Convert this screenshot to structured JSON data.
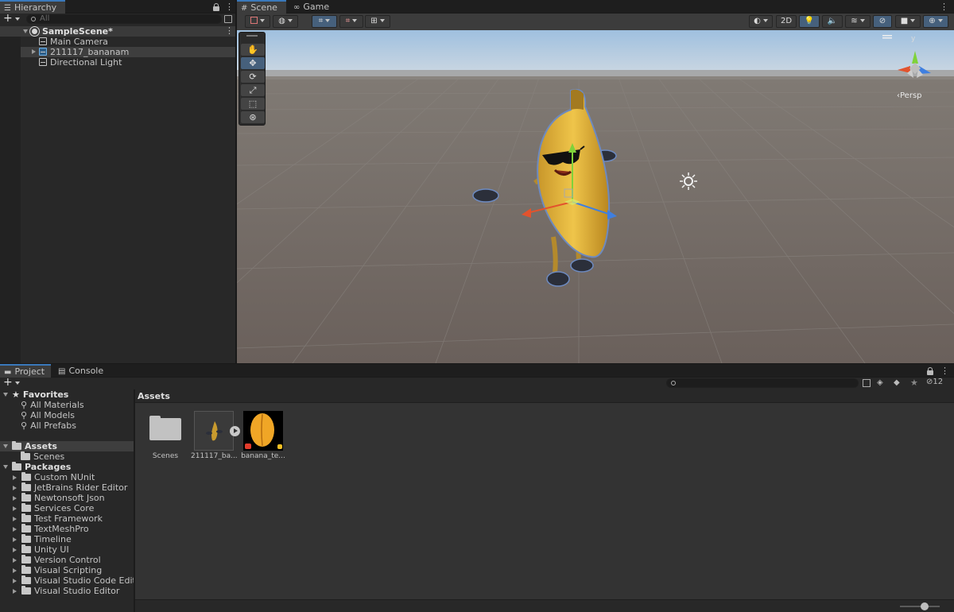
{
  "hierarchy": {
    "tab_label": "Hierarchy",
    "add_label": "+",
    "search_placeholder": "All",
    "scene_name": "SampleScene*",
    "items": [
      {
        "label": "Main Camera"
      },
      {
        "label": "211117_bananam"
      },
      {
        "label": "Directional Light"
      }
    ]
  },
  "scene_view": {
    "tabs": [
      {
        "label": "Scene"
      },
      {
        "label": "Game"
      }
    ],
    "btn_2d": "2D",
    "persp_label": "Persp",
    "gizmo_axis_y": "y"
  },
  "project": {
    "tabs": [
      {
        "label": "Project"
      },
      {
        "label": "Console"
      }
    ],
    "add_label": "+",
    "hidden_count": "12",
    "favorites_label": "Favorites",
    "favorites": [
      {
        "label": "All Materials"
      },
      {
        "label": "All Models"
      },
      {
        "label": "All Prefabs"
      }
    ],
    "assets_label": "Assets",
    "assets_children": [
      {
        "label": "Scenes"
      }
    ],
    "packages_label": "Packages",
    "packages": [
      {
        "label": "Custom NUnit"
      },
      {
        "label": "JetBrains Rider Editor"
      },
      {
        "label": "Newtonsoft Json"
      },
      {
        "label": "Services Core"
      },
      {
        "label": "Test Framework"
      },
      {
        "label": "TextMeshPro"
      },
      {
        "label": "Timeline"
      },
      {
        "label": "Unity UI"
      },
      {
        "label": "Version Control"
      },
      {
        "label": "Visual Scripting"
      },
      {
        "label": "Visual Studio Code Editor"
      },
      {
        "label": "Visual Studio Editor"
      }
    ],
    "breadcrumb": "Assets",
    "grid_items": [
      {
        "label": "Scenes"
      },
      {
        "label": "211117_ba..."
      },
      {
        "label": "banana_te..."
      }
    ]
  },
  "colors": {
    "accent": "#3a79bb",
    "banana_yellow": "#e9b93a",
    "sky": "#b7cfe6",
    "ground": "#6f6560"
  }
}
